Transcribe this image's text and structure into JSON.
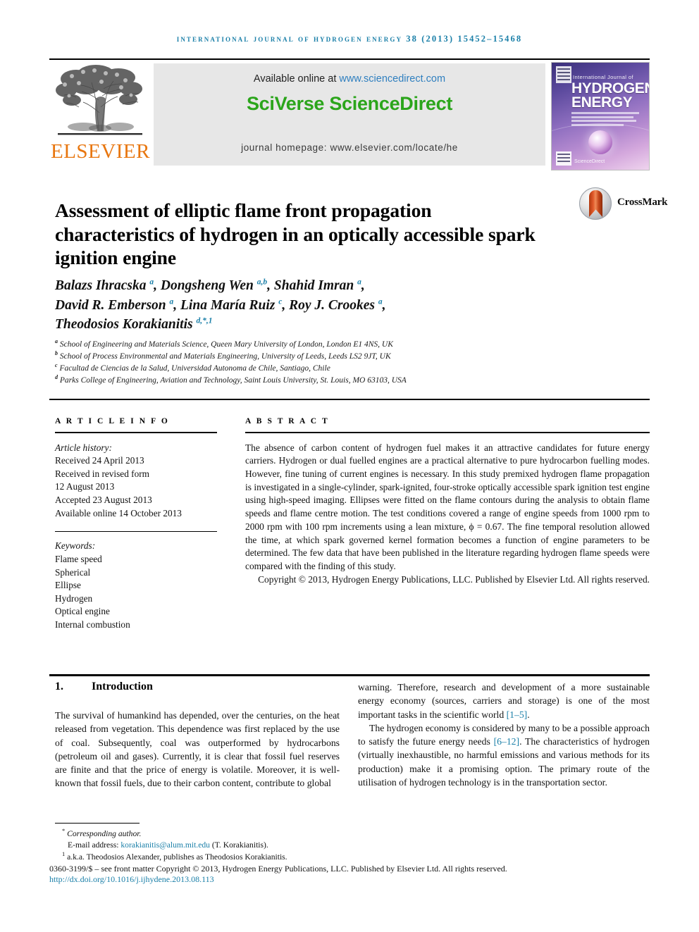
{
  "running_head": "international journal of hydrogen energy 38 (2013) 15452–15468",
  "masthead": {
    "elsevier_wordmark": "ELSEVIER",
    "available_prefix": "Available online at ",
    "available_link": "www.sciencedirect.com",
    "sciverse_title": "SciVerse ScienceDirect",
    "journal_homepage": "journal homepage: www.elsevier.com/locate/he",
    "cover": {
      "kicker": "International Journal of",
      "line1": "HYDROGEN",
      "line2": "ENERGY",
      "publisher_note": "ScienceDirect"
    }
  },
  "crossmark": {
    "label": "CrossMark"
  },
  "article": {
    "title": "Assessment of elliptic flame front propagation characteristics of hydrogen in an optically accessible spark ignition engine",
    "authors_lines": [
      {
        "parts": [
          {
            "t": "Balazs Ihracska ",
            "s": "a"
          },
          {
            "t": ", Dongsheng Wen ",
            "s": "a,b"
          },
          {
            "t": ", Shahid Imran ",
            "s": "a"
          },
          {
            "t": ","
          }
        ]
      },
      {
        "parts": [
          {
            "t": "David R. Emberson ",
            "s": "a"
          },
          {
            "t": ", Lina María Ruiz ",
            "s": "c"
          },
          {
            "t": ", Roy J. Crookes ",
            "s": "a"
          },
          {
            "t": ","
          }
        ]
      },
      {
        "parts": [
          {
            "t": "Theodosios Korakianitis ",
            "s": "d,*,1"
          }
        ]
      }
    ],
    "affiliations": [
      {
        "mark": "a",
        "text": "School of Engineering and Materials Science, Queen Mary University of London, London E1 4NS, UK"
      },
      {
        "mark": "b",
        "text": "School of Process Environmental and Materials Engineering, University of Leeds, Leeds LS2 9JT, UK"
      },
      {
        "mark": "c",
        "text": "Facultad de Ciencias de la Salud, Universidad Autonoma de Chile, Santiago, Chile"
      },
      {
        "mark": "d",
        "text": "Parks College of Engineering, Aviation and Technology, Saint Louis University, St. Louis, MO 63103, USA"
      }
    ]
  },
  "article_info": {
    "heading": "A R T I C L E   I N F O",
    "history_label": "Article history:",
    "history": [
      "Received 24 April 2013",
      "Received in revised form",
      "12 August 2013",
      "Accepted 23 August 2013",
      "Available online 14 October 2013"
    ],
    "keywords_label": "Keywords:",
    "keywords": [
      "Flame speed",
      "Spherical",
      "Ellipse",
      "Hydrogen",
      "Optical engine",
      "Internal combustion"
    ]
  },
  "abstract": {
    "heading": "A B S T R A C T",
    "body": "The absence of carbon content of hydrogen fuel makes it an attractive candidates for future energy carriers. Hydrogen or dual fuelled engines are a practical alternative to pure hydrocarbon fuelling modes. However, fine tuning of current engines is necessary. In this study premixed hydrogen flame propagation is investigated in a single-cylinder, spark-ignited, four-stroke optically accessible spark ignition test engine using high-speed imaging. Ellipses were fitted on the flame contours during the analysis to obtain flame speeds and flame centre motion. The test conditions covered a range of engine speeds from 1000 rpm to 2000 rpm with 100 rpm increments using a lean mixture, ϕ = 0.67. The fine temporal resolution allowed the time, at which spark governed kernel formation becomes a function of engine parameters to be determined. The few data that have been published in the literature regarding hydrogen flame speeds were compared with the finding of this study.",
    "copyright": "Copyright © 2013, Hydrogen Energy Publications, LLC. Published by Elsevier Ltd. All rights reserved."
  },
  "body": {
    "section_number": "1.",
    "section_title": "Introduction",
    "left_paragraph": "The survival of humankind has depended, over the centuries, on the heat released from vegetation. This dependence was first replaced by the use of coal. Subsequently, coal was outperformed by hydrocarbons (petroleum oil and gases). Currently, it is clear that fossil fuel reserves are finite and that the price of energy is volatile. Moreover, it is well-known that fossil fuels, due to their carbon content, contribute to global",
    "right_paragraph_1a": "warning. Therefore, research and development of a more sustainable energy economy (sources, carriers and storage) is one of the most important tasks in the scientific world ",
    "right_paragraph_1_ref": "[1–5]",
    "right_paragraph_1b": ".",
    "right_paragraph_2a": "The hydrogen economy is considered by many to be a possible approach to satisfy the future energy needs ",
    "right_paragraph_2_ref": "[6–12]",
    "right_paragraph_2b": ". The characteristics of hydrogen (virtually inexhaustible, no harmful emissions and various methods for its production) make it a promising option. The primary route of the utilisation of hydrogen technology is in the transportation sector."
  },
  "footnotes": {
    "corresponding": "Corresponding author.",
    "email_label": "E-mail address: ",
    "email": "korakianitis@alum.mit.edu",
    "email_suffix": " (T. Korakianitis).",
    "aka": "a.k.a. Theodosios Alexander, publishes as Theodosios Korakianitis.",
    "issn_copy": "0360-3199/$ – see front matter Copyright © 2013, Hydrogen Energy Publications, LLC. Published by Elsevier Ltd. All rights reserved.",
    "doi": "http://dx.doi.org/10.1016/j.ijhydene.2013.08.113"
  },
  "colors": {
    "accent_blue": "#1a7fa8",
    "sciverse_green": "#2ba51b",
    "elsevier_orange": "#e8760f",
    "link_blue": "#2f7fbf"
  }
}
